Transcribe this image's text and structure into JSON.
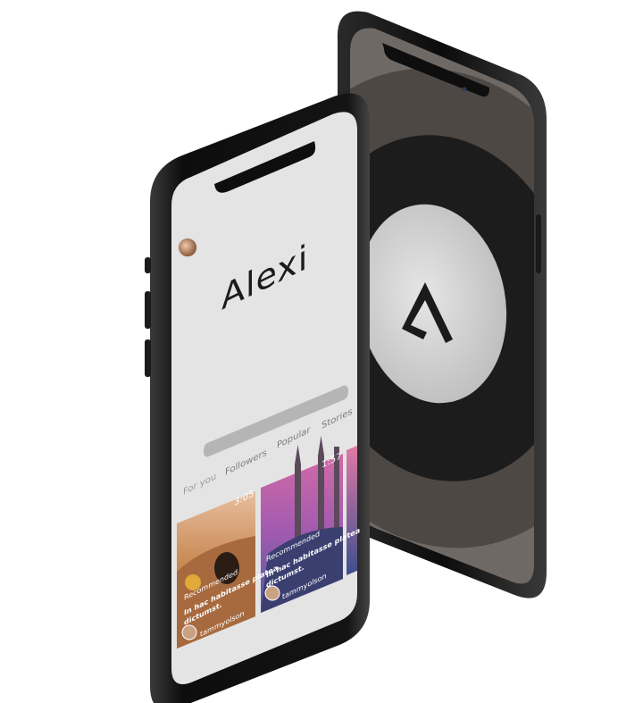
{
  "app": {
    "name": "Alexi",
    "logo_glyph": "△"
  },
  "tabs": [
    {
      "label": "For you"
    },
    {
      "label": "Followers"
    },
    {
      "label": "Popular"
    },
    {
      "label": "Stories"
    }
  ],
  "cards": [
    {
      "duration": "3:05",
      "category": "Recommended",
      "title_line1": "In hac habitasse platea",
      "title_line2": "dictumst.",
      "author": "tammyolson"
    },
    {
      "duration": "1:57",
      "category": "Recommended",
      "title_line1": "In hac habitasse platea",
      "title_line2": "dictumst.",
      "author": "tammyolson"
    }
  ],
  "colors": {
    "frame": "#111111",
    "screen_bg": "#e6e6e6",
    "back_ring_outer": "#595350",
    "back_ring_dark": "#1e1e1e",
    "back_disc": "#d9d9d9"
  }
}
